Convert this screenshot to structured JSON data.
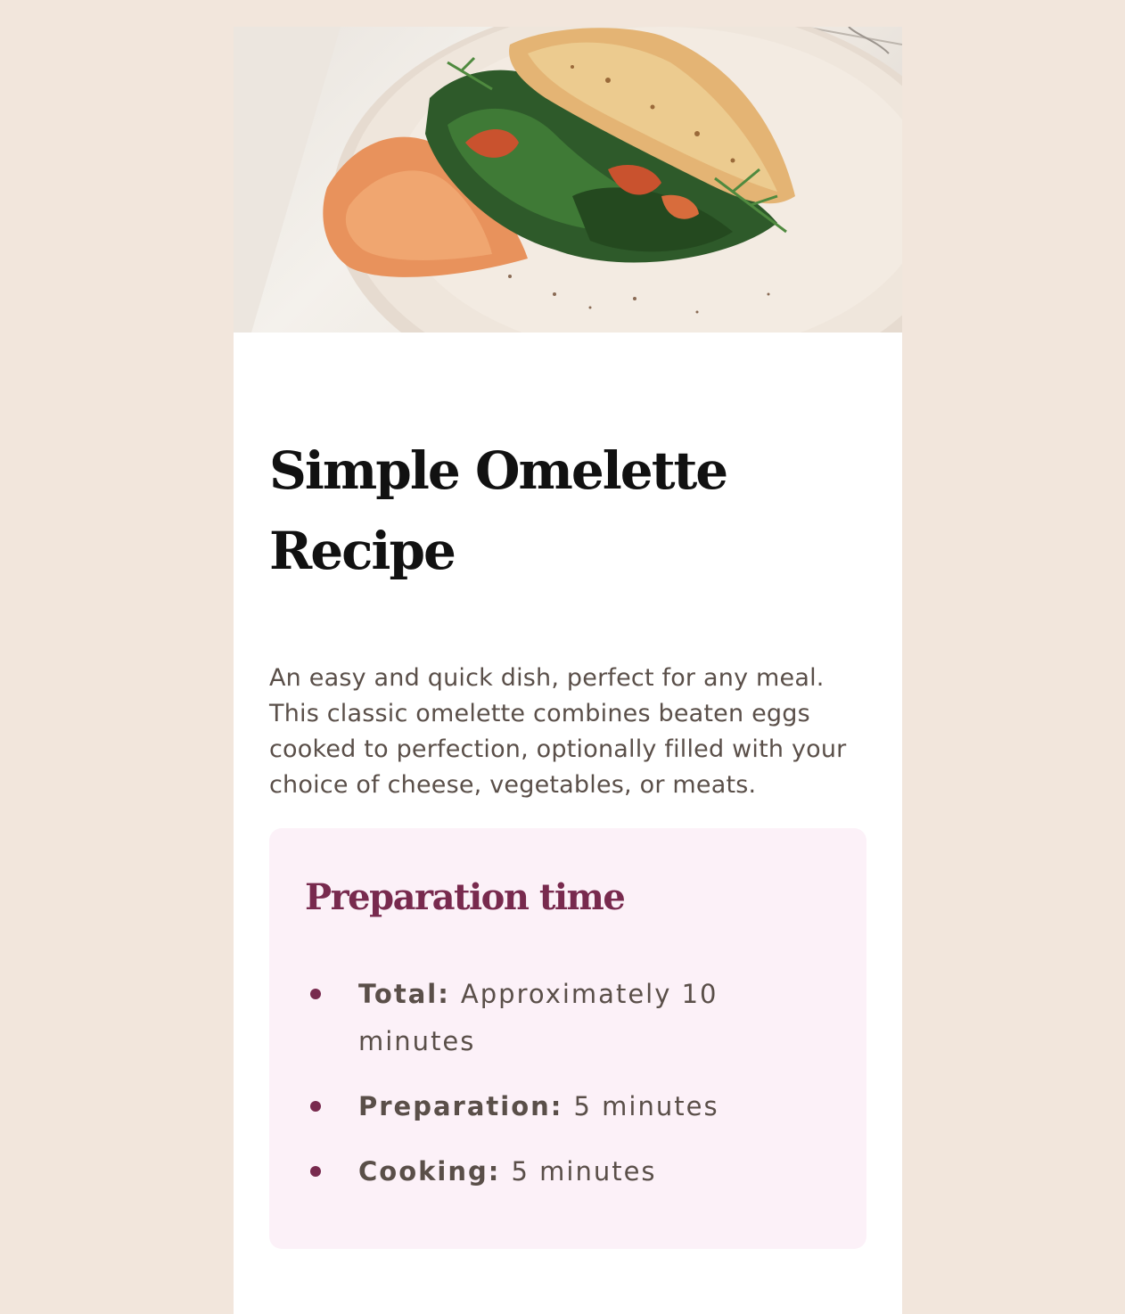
{
  "recipe": {
    "title": "Simple Omelette Recipe",
    "description": "An easy and quick dish, perfect for any meal. This classic omelette combines beaten eggs cooked to perfection, optionally filled with your choice of cheese, vegetables, or meats."
  },
  "preparation": {
    "title": "Preparation time",
    "items": [
      {
        "label": "Total:",
        "value": "Approximately 10 minutes"
      },
      {
        "label": "Preparation:",
        "value": "5 minutes"
      },
      {
        "label": "Cooking:",
        "value": "5 minutes"
      }
    ]
  },
  "colors": {
    "page_background": "#f2e6dc",
    "card_background": "#ffffff",
    "accent": "#782a4e",
    "prep_background": "#fcf1f8",
    "body_text": "#5a4f49"
  },
  "icons": {
    "hero": "omelette-photo",
    "bullet": "bullet-dot-icon"
  }
}
